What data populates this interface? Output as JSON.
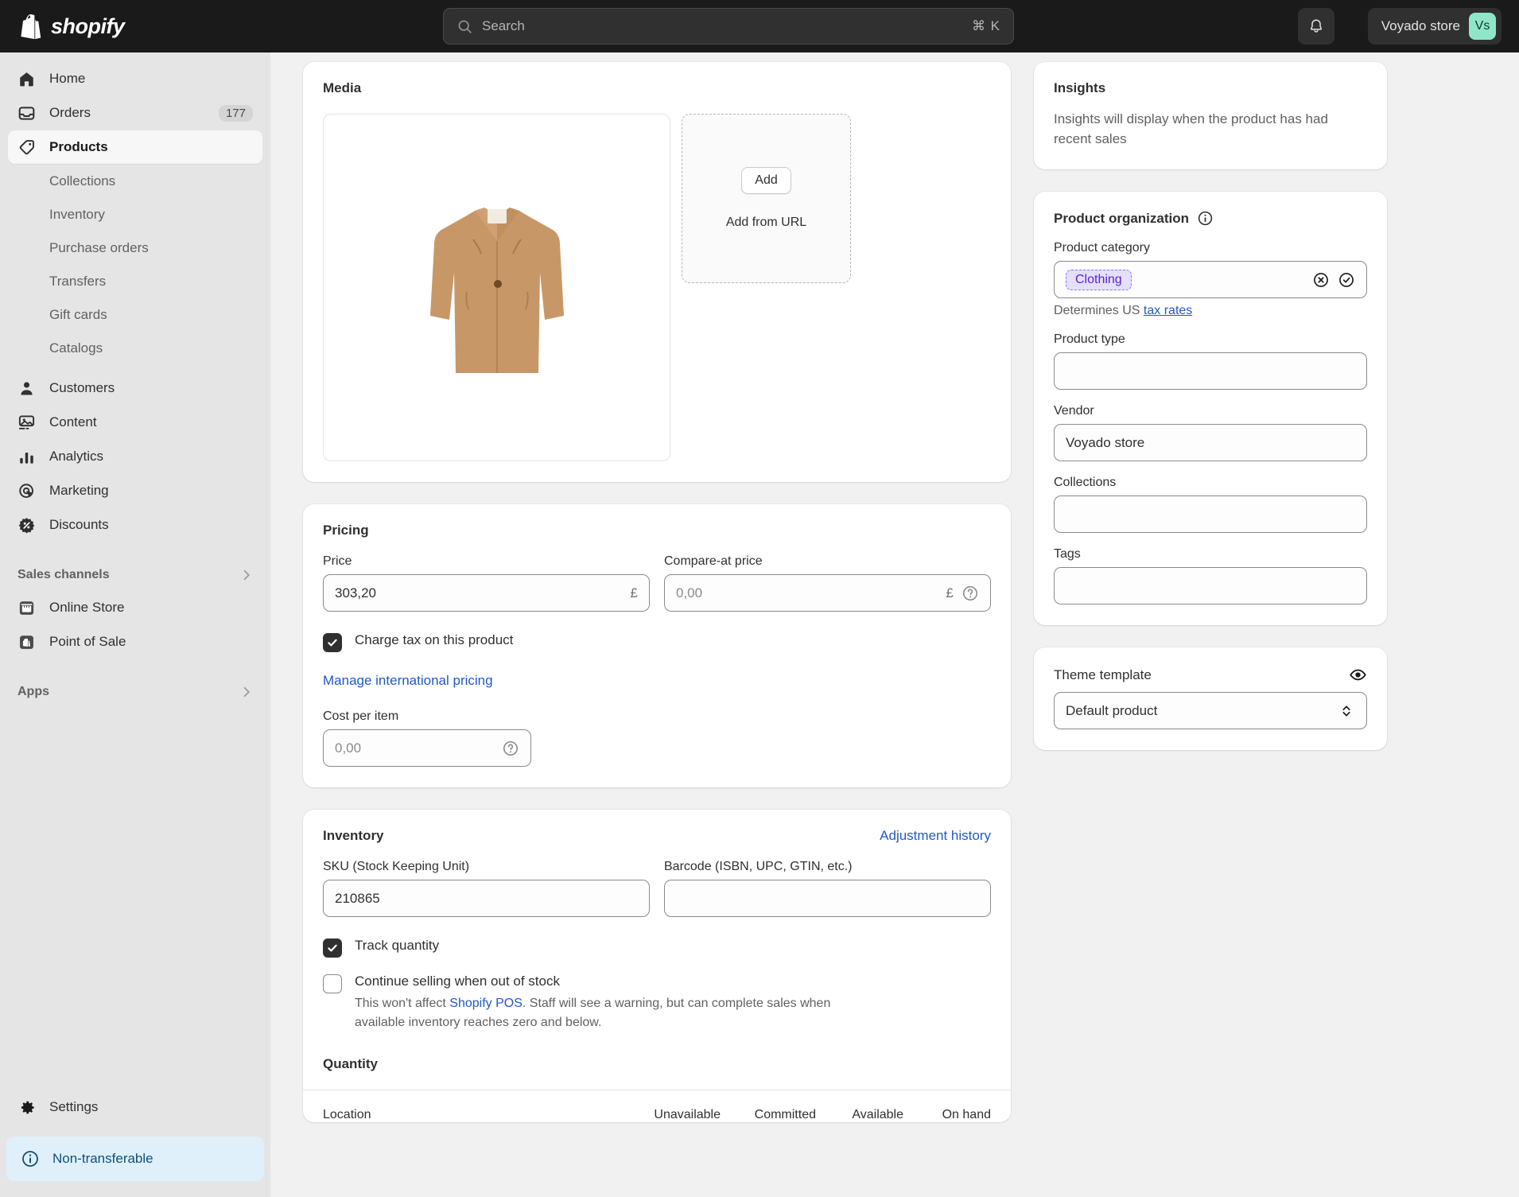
{
  "topbar": {
    "brand": "shopify",
    "search": {
      "placeholder": "Search",
      "shortcut": "⌘ K"
    },
    "store": {
      "name": "Voyado store",
      "initials": "Vs"
    }
  },
  "sidebar": {
    "items": [
      {
        "label": "Home",
        "icon": "home-icon",
        "badge": ""
      },
      {
        "label": "Orders",
        "icon": "orders-icon",
        "badge": "177"
      },
      {
        "label": "Products",
        "icon": "products-tag-icon",
        "badge": "",
        "active": true
      }
    ],
    "product_subitems": [
      {
        "label": "Collections"
      },
      {
        "label": "Inventory"
      },
      {
        "label": "Purchase orders"
      },
      {
        "label": "Transfers"
      },
      {
        "label": "Gift cards"
      },
      {
        "label": "Catalogs"
      }
    ],
    "items2": [
      {
        "label": "Customers",
        "icon": "customer-icon"
      },
      {
        "label": "Content",
        "icon": "content-image-icon"
      },
      {
        "label": "Analytics",
        "icon": "analytics-bars-icon"
      },
      {
        "label": "Marketing",
        "icon": "marketing-target-icon"
      },
      {
        "label": "Discounts",
        "icon": "discounts-badge-icon"
      }
    ],
    "sales_channels": {
      "title": "Sales channels",
      "items": [
        {
          "label": "Online Store",
          "icon": "storefront-icon"
        },
        {
          "label": "Point of Sale",
          "icon": "pos-bag-icon"
        }
      ]
    },
    "apps": {
      "title": "Apps"
    },
    "settings": {
      "label": "Settings",
      "icon": "gear-icon"
    },
    "footer_notice": {
      "label": "Non-transferable",
      "icon": "info-circle-icon"
    }
  },
  "media": {
    "title": "Media",
    "add_button": "Add",
    "add_from_url": "Add from URL",
    "thumbnail_alt": "camel-coat-product-image"
  },
  "pricing": {
    "title": "Pricing",
    "price": {
      "label": "Price",
      "value": "303,20",
      "currency": "£"
    },
    "compare_at": {
      "label": "Compare-at price",
      "value": "0,00",
      "currency": "£"
    },
    "charge_tax": {
      "label": "Charge tax on this product",
      "checked": true
    },
    "manage_intl": "Manage international pricing",
    "cost_per_item": {
      "label": "Cost per item",
      "value": "0,00"
    }
  },
  "inventory": {
    "title": "Inventory",
    "adjustment_history": "Adjustment history",
    "sku": {
      "label": "SKU (Stock Keeping Unit)",
      "value": "210865"
    },
    "barcode": {
      "label": "Barcode (ISBN, UPC, GTIN, etc.)",
      "value": ""
    },
    "track_quantity": {
      "label": "Track quantity",
      "checked": true
    },
    "continue_selling": {
      "label": "Continue selling when out of stock",
      "checked": false,
      "help_prefix": "This won't affect ",
      "help_link": "Shopify POS",
      "help_suffix": ". Staff will see a warning, but can complete sales when available inventory reaches zero and below."
    },
    "quantity_title": "Quantity",
    "quantity_columns": [
      "Location",
      "Unavailable",
      "Committed",
      "Available",
      "On hand"
    ]
  },
  "insights": {
    "title": "Insights",
    "body": "Insights will display when the product has had recent sales"
  },
  "product_organization": {
    "title": "Product organization",
    "info_icon": "info-circle-icon",
    "category": {
      "label": "Product category",
      "tag": "Clothing",
      "determines_prefix": "Determines US ",
      "determines_link": "tax rates"
    },
    "product_type": {
      "label": "Product type",
      "value": ""
    },
    "vendor": {
      "label": "Vendor",
      "value": "Voyado store"
    },
    "collections": {
      "label": "Collections",
      "value": ""
    },
    "tags": {
      "label": "Tags",
      "value": ""
    }
  },
  "theme_template": {
    "label": "Theme template",
    "preview_icon": "eye-icon",
    "selected": "Default product"
  },
  "colors": {
    "topbar_bg": "#1a1a1a",
    "sidebar_bg": "#e5e5e5",
    "page_bg": "#f1f1f1",
    "accent_link": "#2159c7",
    "avatar_bg": "#90e6c8",
    "tag_text": "#5b21d6",
    "tag_bg": "#e4e0fb",
    "notice_bg": "#e0f0fa"
  }
}
